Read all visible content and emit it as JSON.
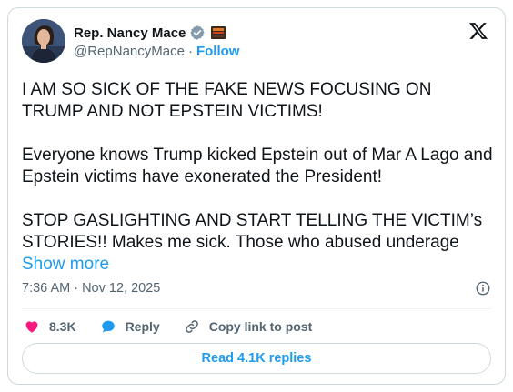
{
  "author": {
    "display_name": "Rep. Nancy Mace",
    "handle": "@RepNancyMace",
    "separator": "·",
    "follow_label": "Follow"
  },
  "tweet": {
    "paragraph1": "I AM SO SICK OF THE FAKE NEWS FOCUSING ON TRUMP AND NOT EPSTEIN VICTIMS!",
    "paragraph2": "Everyone knows Trump kicked Epstein out of Mar A Lago and Epstein victims have exonerated the President!",
    "paragraph3": "STOP GASLIGHTING AND START TELLING THE VICTIM’s STORIES!! Makes me sick. Those who abused underage",
    "show_more_label": "Show more",
    "timestamp": "7:36 AM · Nov 12, 2025"
  },
  "actions": {
    "likes": "8.3K",
    "reply_label": "Reply",
    "copy_link_label": "Copy link to post"
  },
  "read_replies_label": "Read 4.1K replies",
  "icons": [
    "verified-badge-icon",
    "flag-icon",
    "x-logo-icon",
    "info-icon",
    "heart-icon",
    "reply-bubble-icon",
    "link-icon"
  ],
  "colors": {
    "accent": "#1d9bf0",
    "like": "#f91880",
    "text": "#0f1419",
    "secondary": "#536471",
    "border": "#cfd9de"
  }
}
